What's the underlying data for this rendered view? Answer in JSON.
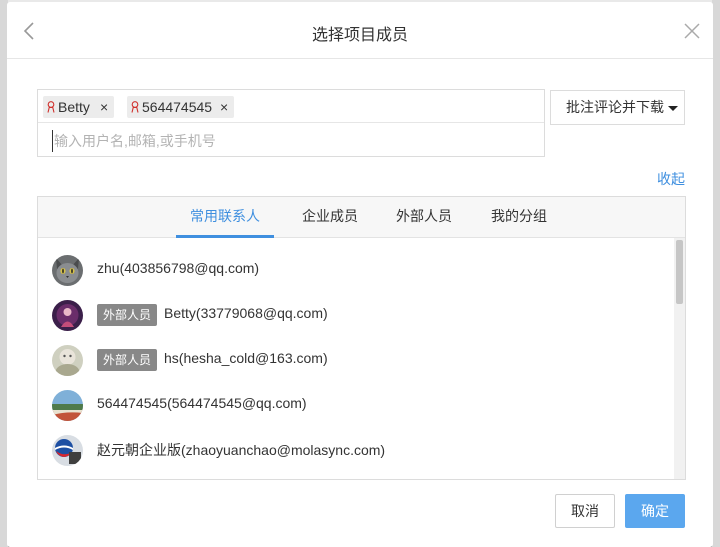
{
  "dialog": {
    "title": "选择项目成员"
  },
  "picker": {
    "selected": [
      {
        "label": "Betty",
        "remove": "×"
      },
      {
        "label": "564474545",
        "remove": "×"
      }
    ],
    "search_placeholder": "输入用户名,邮箱,或手机号"
  },
  "download_button": {
    "label": "批注评论并下载"
  },
  "collapse_link": "收起",
  "tabs": [
    {
      "label": "常用联系人",
      "active": true
    },
    {
      "label": "企业成员",
      "active": false
    },
    {
      "label": "外部人员",
      "active": false
    },
    {
      "label": "我的分组",
      "active": false
    }
  ],
  "contacts": [
    {
      "text": "zhu(403856798@qq.com)",
      "badge": ""
    },
    {
      "text": "Betty(33779068@qq.com)",
      "badge": "外部人员"
    },
    {
      "text": "hs(hesha_cold@163.com)",
      "badge": "外部人员"
    },
    {
      "text": "564474545(564474545@qq.com)",
      "badge": ""
    },
    {
      "text": "赵元朝企业版(zhaoyuanchao@molasync.com)",
      "badge": ""
    }
  ],
  "footer": {
    "cancel": "取消",
    "ok": "确定"
  },
  "colors": {
    "accent": "#3f8fdf",
    "primary_button": "#5ba7ee",
    "badge": "#888888"
  }
}
